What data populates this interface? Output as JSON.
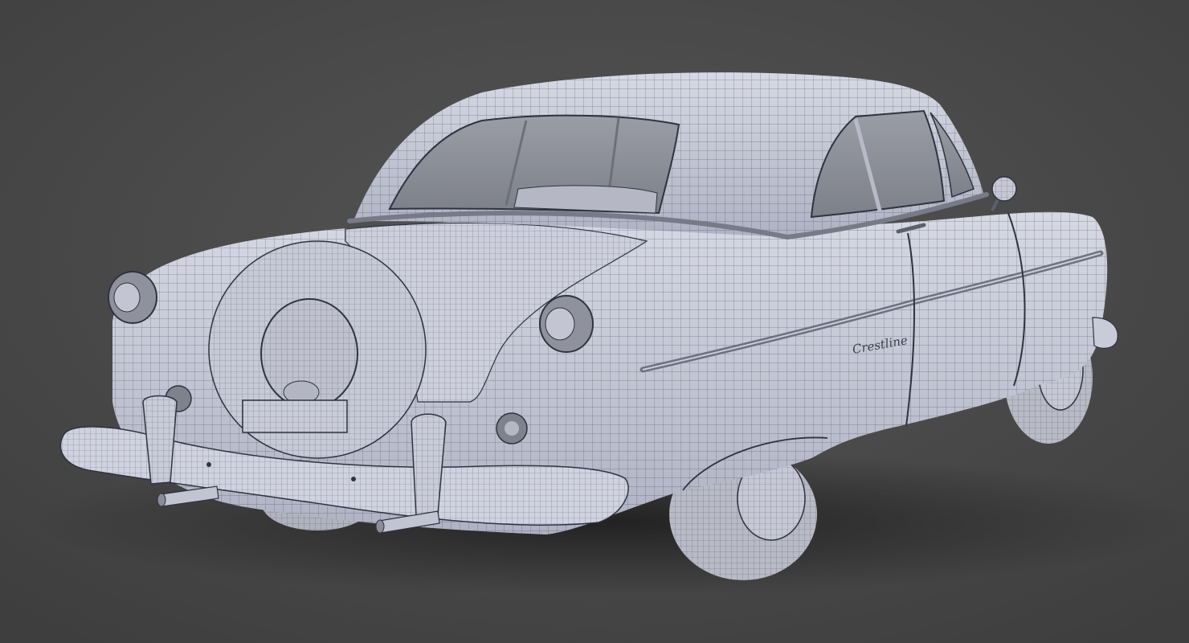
{
  "scene": {
    "subject": "wireframe-car-render",
    "background_color": "#4a4a4a",
    "floor_color": "#3f3f3f",
    "body_color": "#c9ccd9",
    "body_shade_color": "#a9adbd",
    "wire_color": "#2f3340",
    "glass_color": "#8c8f98",
    "tire_color": "#b8bac6",
    "shadow_color": "#262626"
  },
  "badge": {
    "script_text": "Crestline"
  }
}
